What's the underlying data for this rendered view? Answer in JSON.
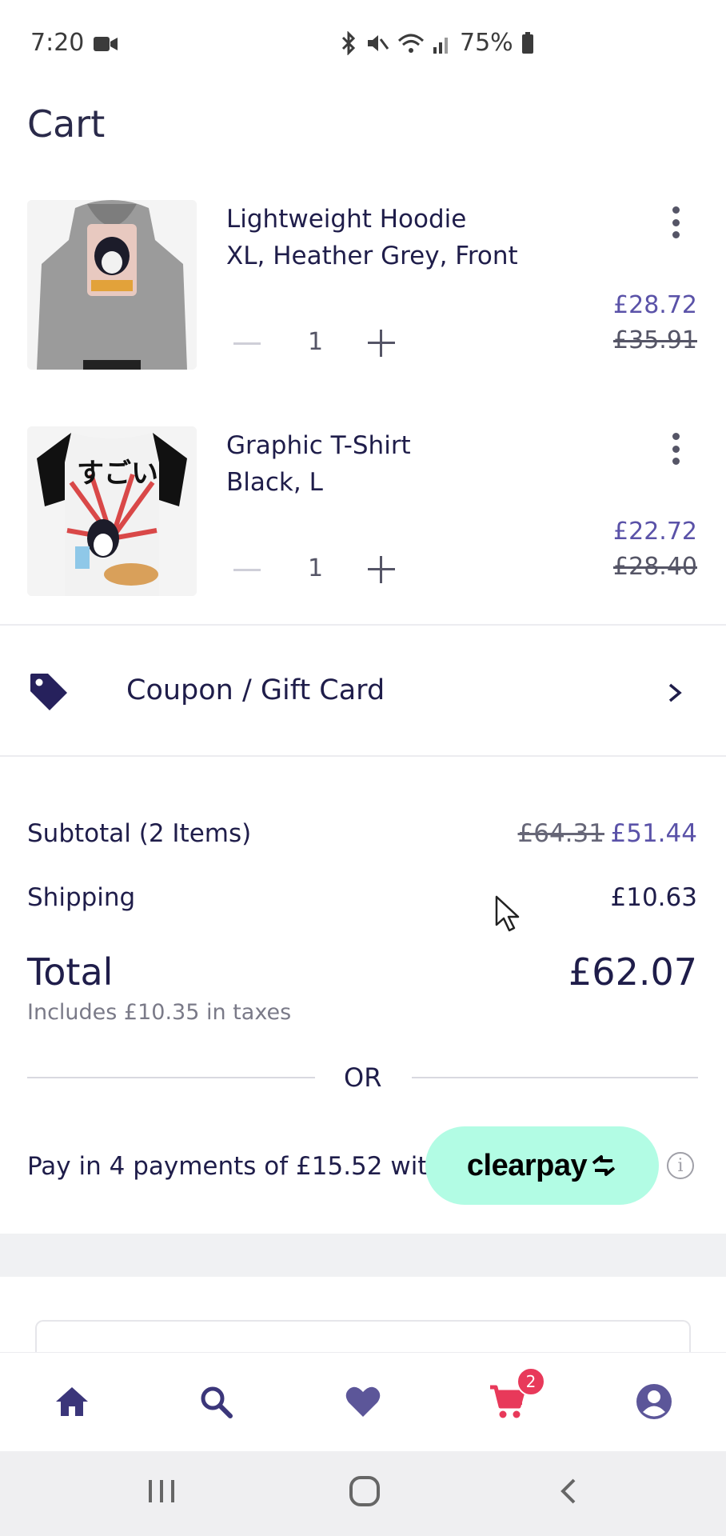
{
  "status_bar": {
    "time": "7:20",
    "battery": "75%"
  },
  "page": {
    "title": "Cart"
  },
  "cart": {
    "items": [
      {
        "name": "Lightweight Hoodie",
        "details": "XL, Heather Grey, Front",
        "quantity": "1",
        "price": "£28.72",
        "original_price": "£35.91"
      },
      {
        "name": "Graphic T-Shirt",
        "details": "Black, L",
        "quantity": "1",
        "price": "£22.72",
        "original_price": "£28.40"
      }
    ]
  },
  "coupon": {
    "label": "Coupon / Gift Card"
  },
  "summary": {
    "subtotal_label": "Subtotal (2 Items)",
    "subtotal_original": "£64.31",
    "subtotal": "£51.44",
    "shipping_label": "Shipping",
    "shipping": "£10.63",
    "total_label": "Total",
    "total": "£62.07",
    "tax_note": "Includes £10.35 in taxes"
  },
  "divider_text": "OR",
  "installments": {
    "text": "Pay in 4 payments of £15.52 with",
    "brand": "clearpay"
  },
  "bottom_nav": {
    "cart_badge": "2",
    "items": [
      "home-icon",
      "search-icon",
      "heart-icon",
      "cart-icon",
      "account-icon"
    ]
  },
  "colors": {
    "accent": "#5a52a8",
    "text": "#1f1d4a",
    "cart_active": "#e8395a",
    "clearpay_bg": "#b2fce4"
  }
}
